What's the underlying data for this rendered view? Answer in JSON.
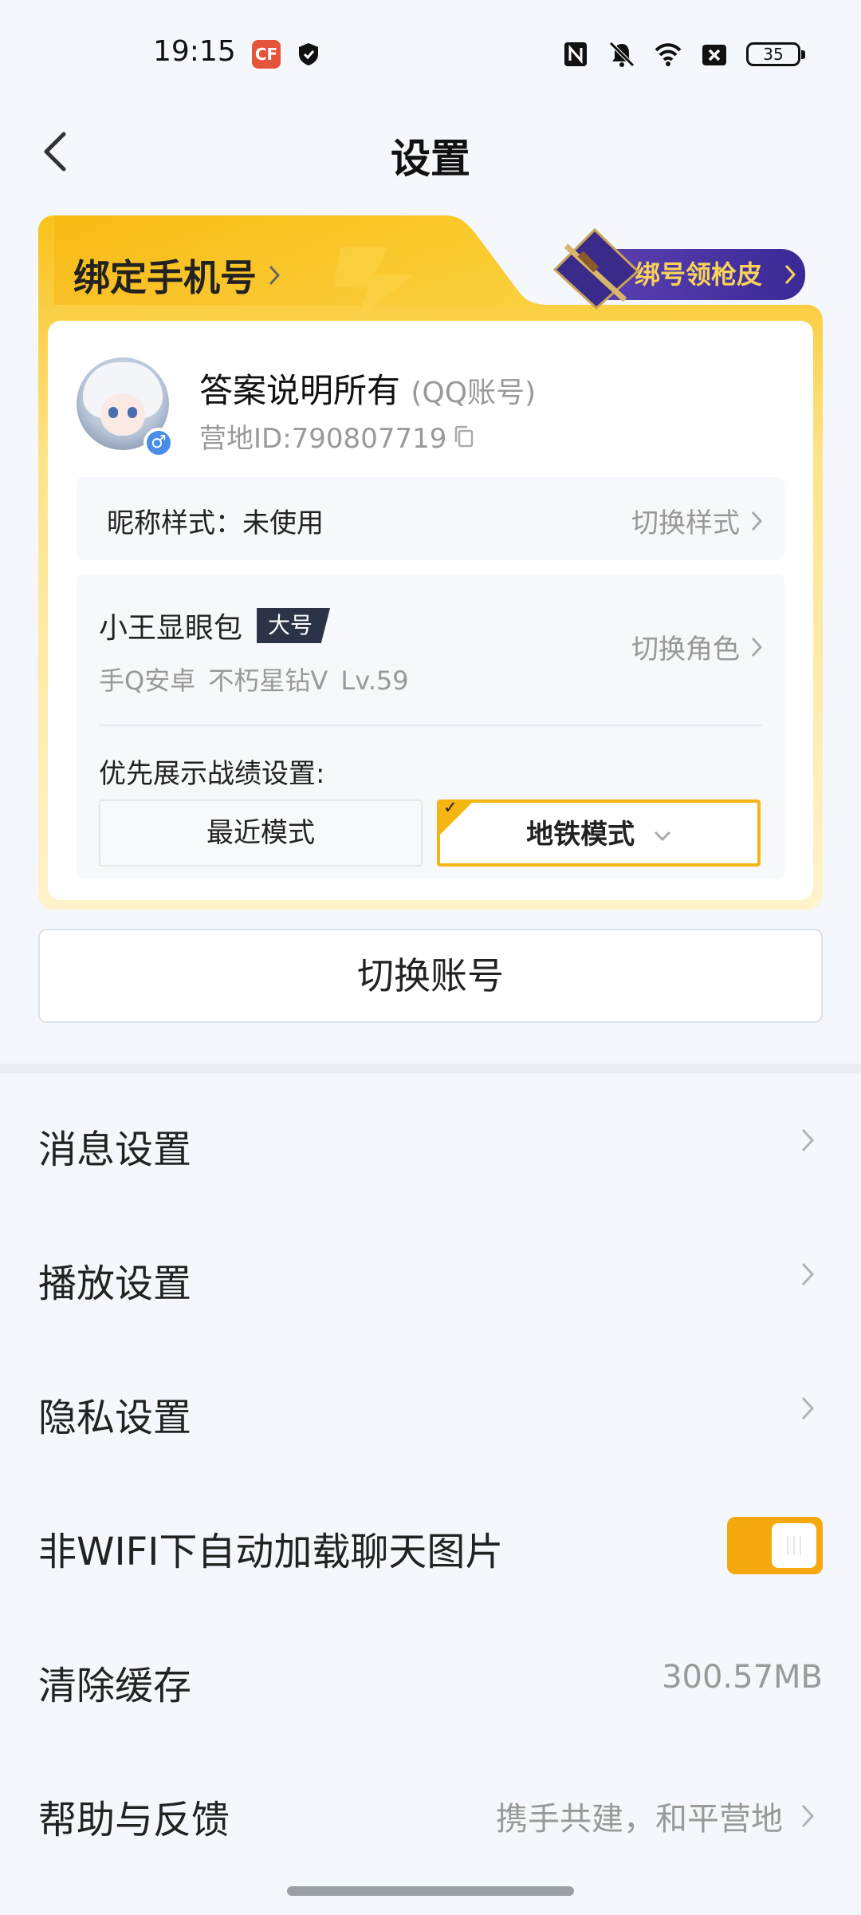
{
  "status_bar": {
    "time": "19:15",
    "app_icon_1": "CF",
    "battery": "35",
    "icons": [
      "nfc-icon",
      "bell-off-icon",
      "wifi-icon",
      "sim-off-icon",
      "battery-icon"
    ]
  },
  "header": {
    "title": "设置",
    "back_icon": "back-arrow-icon"
  },
  "account_card": {
    "bind_phone": "绑定手机号",
    "promo": "绑号领枪皮",
    "username": "答案说明所有",
    "account_type": "(QQ账号)",
    "camp_id": "营地ID:790807719",
    "nickname_style_label": "昵称样式：未使用",
    "nickname_style_action": "切换样式",
    "role": {
      "name": "小王显眼包",
      "badge": "大号",
      "subtitle": "手Q安卓  不朽星钻V  Lv.59",
      "switch_action": "切换角色"
    },
    "priority_label": "优先展示战绩设置:",
    "mode_recent": "最近模式",
    "mode_metro": "地铁模式",
    "check_mark": "✓"
  },
  "switch_account": "切换账号",
  "settings": [
    {
      "label": "消息设置"
    },
    {
      "label": "播放设置"
    },
    {
      "label": "隐私设置"
    },
    {
      "label": "非WIFI下自动加载聊天图片",
      "toggle": true
    },
    {
      "label": "清除缓存",
      "value": "300.57MB"
    },
    {
      "label": "帮助与反馈",
      "value": "携手共建，和平营地"
    }
  ],
  "colors": {
    "accent": "#f5b512",
    "toggle_on": "#f5a90f",
    "promo_bg": "#4a33a3",
    "promo_text": "#f7d35a",
    "page_bg": "#f4f8fc"
  }
}
